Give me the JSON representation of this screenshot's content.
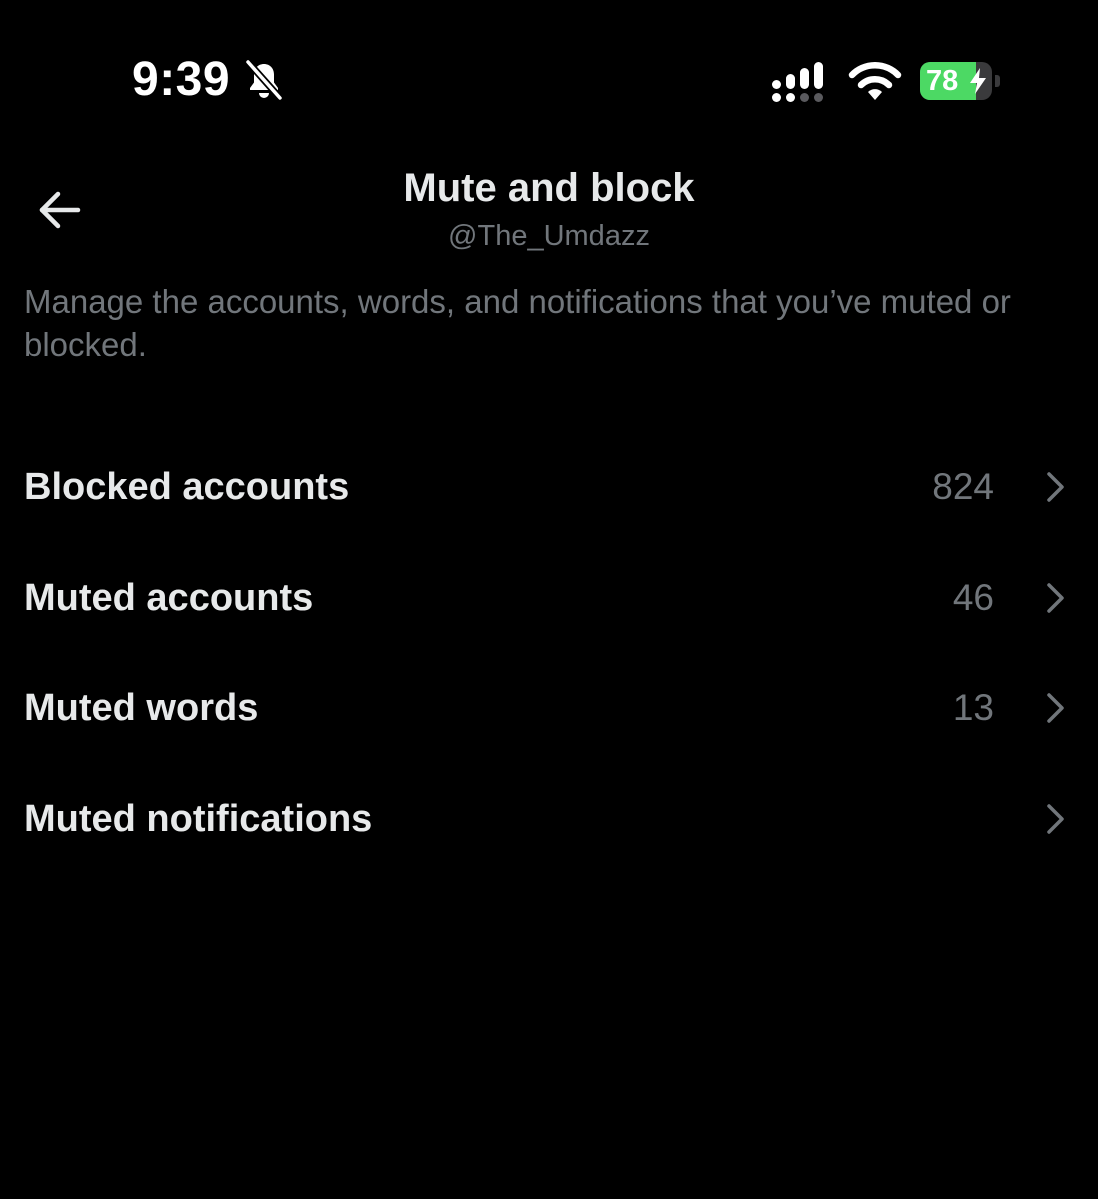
{
  "status_bar": {
    "time": "9:39",
    "battery_level": "78",
    "battery_fraction": 0.78,
    "icons": [
      "bell-off-icon",
      "signal-icon",
      "wifi-icon",
      "battery-icon",
      "charging-bolt-icon"
    ]
  },
  "header": {
    "title": "Mute and block",
    "handle": "@The_Umdazz",
    "back_icon": "arrow-left-icon"
  },
  "description": "Manage the accounts, words, and notifications that you’ve muted or blocked.",
  "items": [
    {
      "label": "Blocked accounts",
      "count": "824",
      "icon": "chevron-right-icon"
    },
    {
      "label": "Muted accounts",
      "count": "46",
      "icon": "chevron-right-icon"
    },
    {
      "label": "Muted words",
      "count": "13",
      "icon": "chevron-right-icon"
    },
    {
      "label": "Muted notifications",
      "count": "",
      "icon": "chevron-right-icon"
    }
  ],
  "colors": {
    "background": "#000000",
    "primary_text": "#e7e9ea",
    "secondary_text": "#71767b",
    "battery_green": "#4cd964"
  }
}
